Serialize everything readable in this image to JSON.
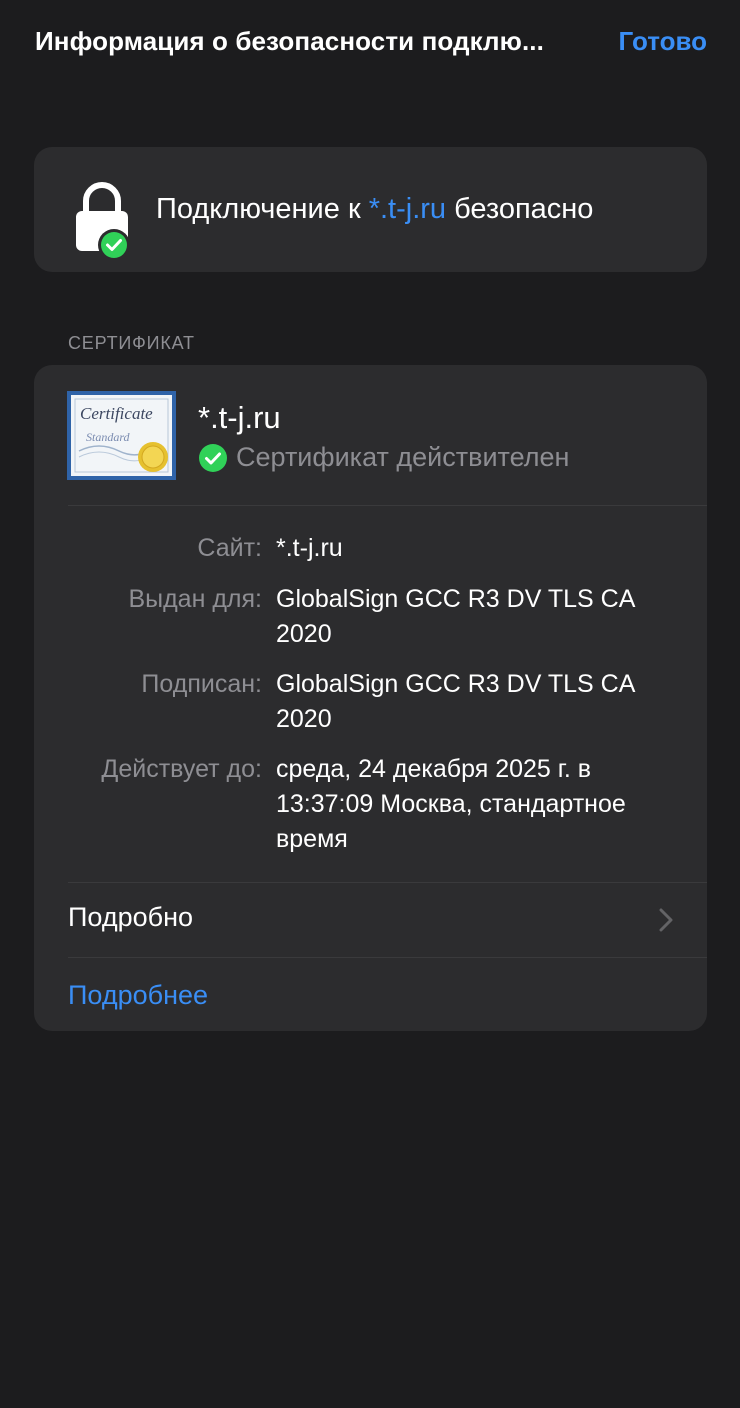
{
  "header": {
    "title": "Информация о безопасности подклю...",
    "done_label": "Готово"
  },
  "connection": {
    "prefix": "Подключение к ",
    "host": "*.t-j.ru",
    "suffix": " безопасно",
    "icon": "lock-check-icon"
  },
  "certificate": {
    "section_label": "СЕРТИФИКАТ",
    "icon": "certificate-icon",
    "icon_text_1": "Certificate",
    "icon_text_2": "Standard",
    "name": "*.t-j.ru",
    "status": "Сертификат действителен",
    "details": [
      {
        "label": "Сайт:",
        "value": "*.t-j.ru"
      },
      {
        "label": "Выдан для:",
        "value": "GlobalSign GCC R3 DV TLS CA 2020"
      },
      {
        "label": "Подписан:",
        "value": "GlobalSign GCC R3 DV TLS CA 2020"
      },
      {
        "label": "Действует до:",
        "value": "среда, 24 декабря 2025 г. в 13:37:09 Москва, стандарт­ное время"
      }
    ],
    "more_label": "Подробно",
    "learn_more_label": "Подробнее"
  },
  "colors": {
    "background": "#1c1c1e",
    "card": "#2c2c2e",
    "accent": "#3a8ef5",
    "success": "#30d158",
    "secondary_text": "#8e8e93"
  }
}
